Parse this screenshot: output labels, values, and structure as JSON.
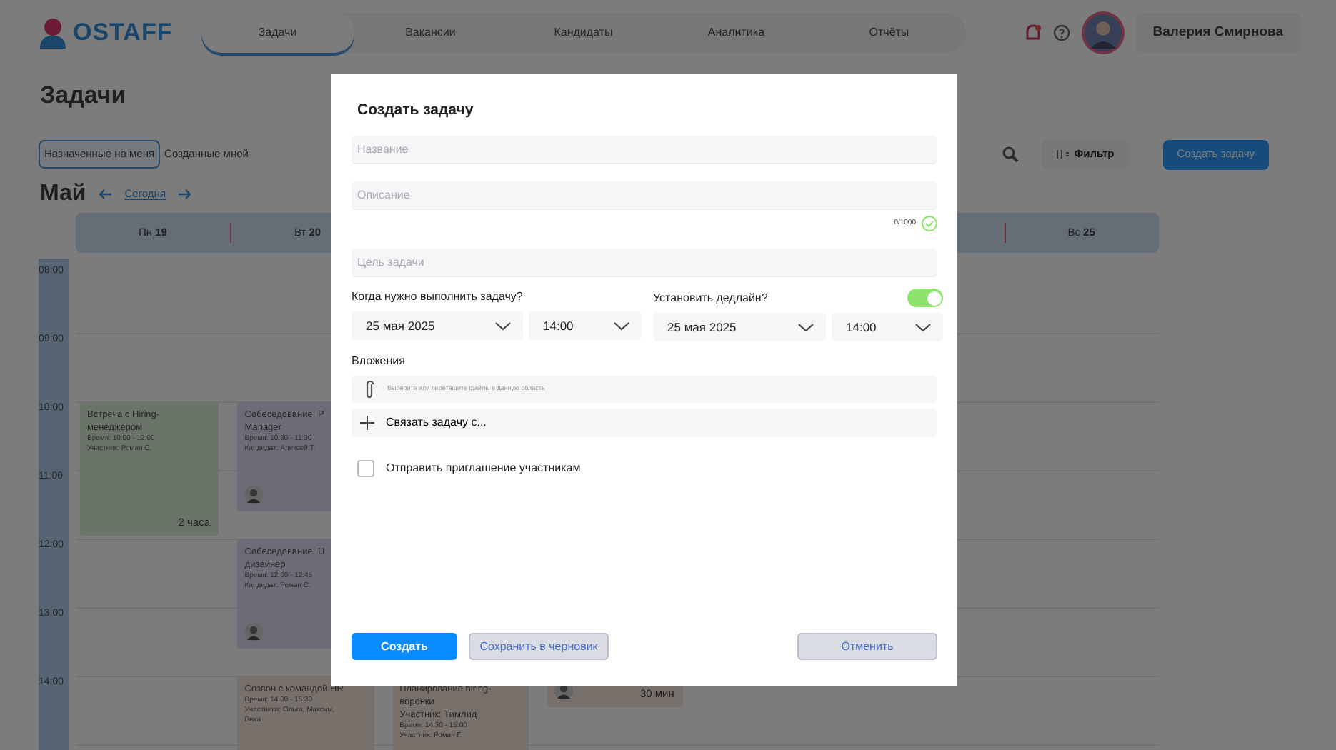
{
  "header": {
    "logo": "OSTAFF",
    "nav": [
      {
        "label": "Задачи",
        "selected": true
      },
      {
        "label": "Вакансии",
        "selected": false
      },
      {
        "label": "Кандидаты",
        "selected": false
      },
      {
        "label": "Аналитика",
        "selected": false
      },
      {
        "label": "Отчёты",
        "selected": false
      }
    ],
    "user_name": "Валерия Смирнова"
  },
  "page": {
    "title": "Задачи",
    "filter_tabs": [
      {
        "label": "Назначенные на меня",
        "selected": true
      },
      {
        "label": "Созданные мной",
        "selected": false
      }
    ],
    "filter_button": "Фильтр",
    "create_button": "Создать задачу",
    "month": "Май",
    "today_link": "Сегодня"
  },
  "calendar": {
    "days": [
      {
        "name": "Пн",
        "number": "19"
      },
      {
        "name": "Вт",
        "number": "20"
      },
      {
        "name": "Вс",
        "number": "25"
      }
    ],
    "hours": [
      "08:00",
      "09:00",
      "10:00",
      "11:00",
      "12:00",
      "13:00",
      "14:00"
    ],
    "events": [
      {
        "kind": "meeting",
        "title": [
          "Встреча с Hiring-",
          "менеджером"
        ],
        "details": [
          "Время: 10:00 - 12:00",
          "Участник: Роман С."
        ],
        "duration": "2 часа"
      },
      {
        "kind": "interview",
        "title": [
          "Собеседование: P",
          "Manager"
        ],
        "details": [
          "Время: 10:30 - 11:30",
          "Кандидат: Алексей Т."
        ],
        "avatar": true
      },
      {
        "kind": "interview",
        "title": [
          "Собеседование: U",
          "дизайнер"
        ],
        "details": [
          "Время: 12:00 - 12:45",
          "Кандидат: Роман С."
        ],
        "avatar": true
      },
      {
        "kind": "call",
        "title": [
          "Созвон с командой HR"
        ],
        "details": [
          "Время: 14:00 - 15:30",
          "Участники: Ольга, Максим,",
          "Вика"
        ]
      },
      {
        "kind": "call",
        "title": [
          "Планирование hiring-",
          "воронки",
          "Участник: Тимлид"
        ],
        "details": [
          "Время: 14:30 - 15:00",
          "Участник: Роман Г."
        ]
      },
      {
        "kind": "call",
        "duration": "30 мин",
        "avatar": true
      }
    ]
  },
  "modal": {
    "title": "Создать задачу",
    "fields": [
      {
        "placeholder": "Название"
      },
      {
        "placeholder": "Описание",
        "counter": "0/1000"
      },
      {
        "placeholder": "Цель задачи"
      }
    ],
    "when": {
      "label": "Когда нужно выполнить задачу?",
      "date": "25 мая 2025",
      "time": "14:00"
    },
    "deadline": {
      "label": "Установить дедлайн?",
      "on": true,
      "date": "25 мая 2025",
      "time": "14:00"
    },
    "attachments": {
      "label": "Вложения",
      "placeholder": "Выберите или перетащите файлы в данную область"
    },
    "link": "Связать задачу с...",
    "invite": {
      "label": "Отправить приглашение участникам",
      "checked": false
    },
    "buttons": {
      "create": "Создать",
      "draft": "Сохранить в черновик",
      "cancel": "Отменить"
    }
  }
}
